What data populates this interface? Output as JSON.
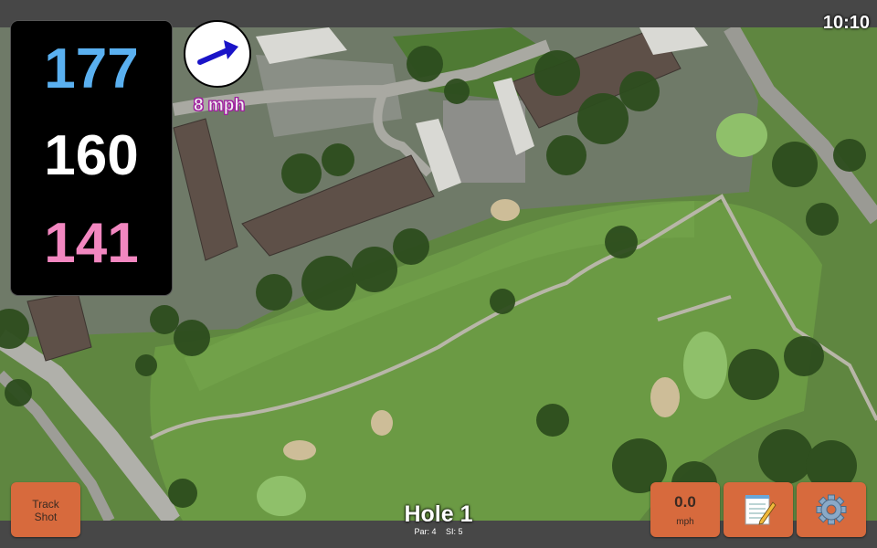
{
  "status": {
    "clock": "10:10"
  },
  "yardage": {
    "back": "177",
    "middle": "160",
    "front": "141"
  },
  "wind": {
    "speed_label": "8 mph",
    "icon": "wind-arrow-icon",
    "arrow_color": "#1a14c8"
  },
  "buttons": {
    "track_shot_line1": "Track",
    "track_shot_line2": "Shot",
    "wind_speed_value": "0.0",
    "wind_speed_unit": "mph",
    "notes_icon": "notepad-icon",
    "settings_icon": "gear-icon"
  },
  "hole": {
    "title": "Hole 1",
    "par": "Par: 4",
    "si": "SI: 5"
  },
  "colors": {
    "back": "#5ab0f0",
    "middle": "#ffffff",
    "front": "#f287c0",
    "button": "#d76a3d"
  }
}
